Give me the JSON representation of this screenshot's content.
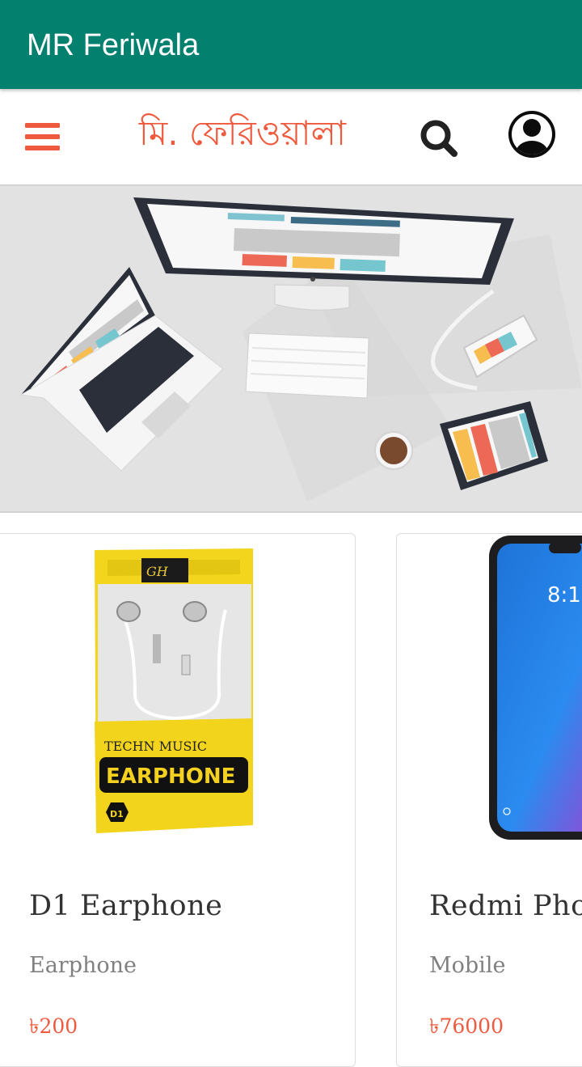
{
  "app_bar": {
    "title": "MR Feriwala",
    "color": "#04806f"
  },
  "top_nav": {
    "logo_text": "মি. ফেরিওয়ালা",
    "logo_color": "#ef5a3e",
    "menu_icon": "hamburger-menu-icon",
    "search_icon": "search-icon",
    "account_icon": "account-circle-icon"
  },
  "banner": {
    "illustration": "desk-devices-illustration"
  },
  "products": [
    {
      "name": "D1 Earphone",
      "category": "Earphone",
      "price": "৳200",
      "image": "earphone-package",
      "package_text": {
        "brand": "GH",
        "tagline": "TECHN MUSIC",
        "headline": "EARPHONE",
        "model": "D1"
      }
    },
    {
      "name": "Redmi Phone",
      "category": "Mobile",
      "price": "৳76000",
      "image": "smartphone",
      "screen_time": "8:1"
    }
  ],
  "colors": {
    "accent": "#ef5a3e",
    "primary": "#04806f",
    "text_dark": "#333333",
    "text_muted": "#808080"
  }
}
